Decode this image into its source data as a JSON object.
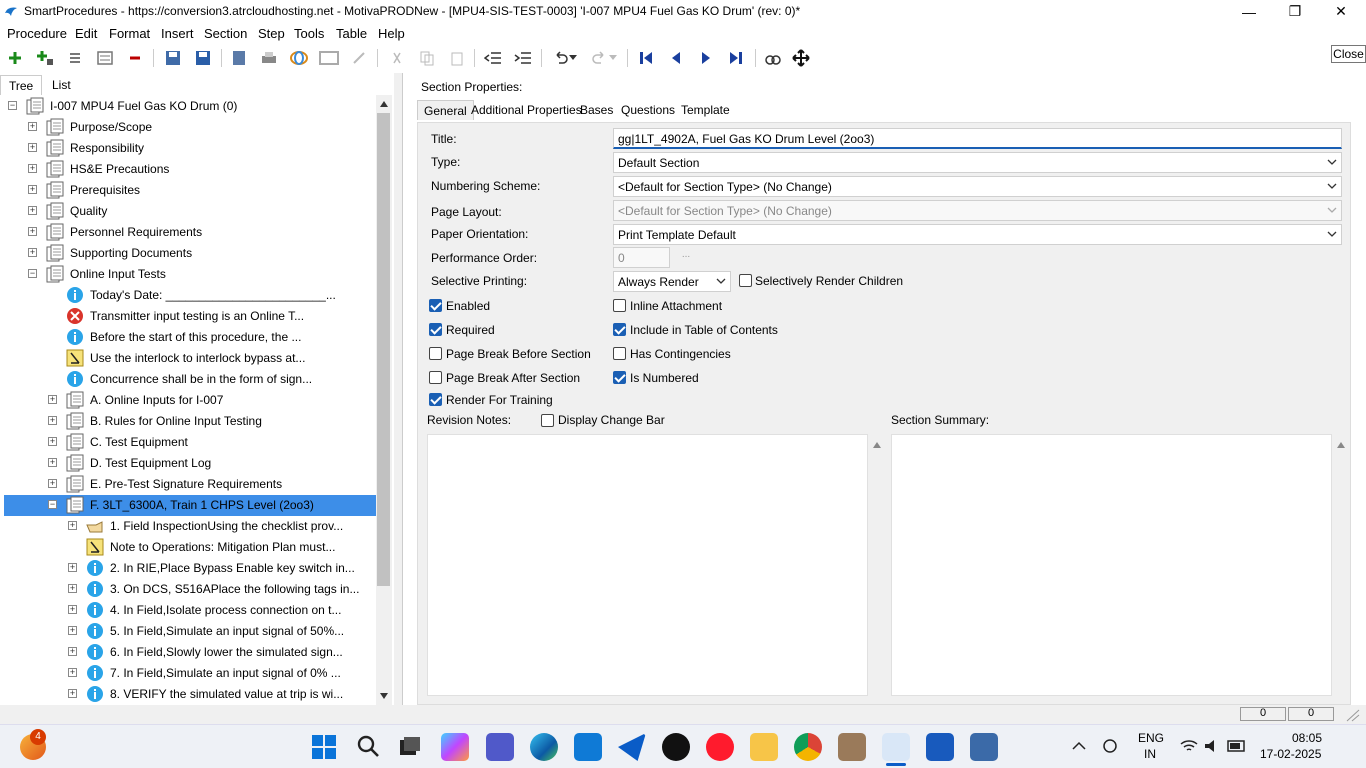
{
  "window": {
    "title": "SmartProcedures - https://conversion3.atrcloudhosting.net - MotivaPRODNew - [MPU4-SIS-TEST-0003] 'I-007 MPU4 Fuel Gas KO Drum' (rev: 0)*",
    "minimize": "—",
    "maximize": "❐",
    "close": "✕"
  },
  "menu": [
    "Procedure",
    "Edit",
    "Format",
    "Insert",
    "Section",
    "Step",
    "Tools",
    "Table",
    "Help"
  ],
  "close_button": "Close",
  "left_tabs": [
    "Tree",
    "List"
  ],
  "tree": [
    {
      "label": "I-007 MPU4 Fuel Gas KO Drum (0)",
      "icon": "document-icon",
      "pm": "−"
    },
    {
      "label": "Purpose/Scope",
      "icon": "document-icon",
      "pm": "+"
    },
    {
      "label": "Responsibility",
      "icon": "document-icon",
      "pm": "+"
    },
    {
      "label": "HS&E Precautions",
      "icon": "document-icon",
      "pm": "+"
    },
    {
      "label": "Prerequisites",
      "icon": "document-icon",
      "pm": "+"
    },
    {
      "label": "Quality",
      "icon": "document-icon",
      "pm": "+"
    },
    {
      "label": "Personnel Requirements",
      "icon": "document-icon",
      "pm": "+"
    },
    {
      "label": "Supporting Documents",
      "icon": "document-icon",
      "pm": "+"
    },
    {
      "label": "Online Input Tests",
      "icon": "document-icon",
      "pm": "−"
    },
    {
      "label": "Today's Date: ________________________...",
      "icon": "info-icon",
      "pm": ""
    },
    {
      "label": "Transmitter input testing is an Online T...",
      "icon": "error-icon",
      "pm": ""
    },
    {
      "label": "Before the start of this procedure, the ...",
      "icon": "info-icon",
      "pm": ""
    },
    {
      "label": "Use the interlock to interlock bypass at...",
      "icon": "warning-icon",
      "pm": ""
    },
    {
      "label": "Concurrence shall be in the form of sign...",
      "icon": "info-icon",
      "pm": ""
    },
    {
      "label": "A. Online Inputs for I-007",
      "icon": "document-icon",
      "pm": "+"
    },
    {
      "label": "B. Rules for Online Input Testing",
      "icon": "document-icon",
      "pm": "+"
    },
    {
      "label": "C. Test Equipment",
      "icon": "document-icon",
      "pm": "+"
    },
    {
      "label": "D. Test Equipment Log",
      "icon": "document-icon",
      "pm": "+"
    },
    {
      "label": "E. Pre-Test Signature Requirements",
      "icon": "document-icon",
      "pm": "+"
    },
    {
      "label": "F. 3LT_6300A, Train 1 CHPS Level (2oo3)",
      "icon": "document-icon",
      "pm": "−"
    },
    {
      "label": "1. Field InspectionUsing the checklist prov...",
      "icon": "hand-pointer-icon",
      "pm": "+"
    },
    {
      "label": "Note to Operations: Mitigation Plan must...",
      "icon": "warning-icon",
      "pm": ""
    },
    {
      "label": "2. In RIE,Place Bypass Enable key switch in...",
      "icon": "info-icon",
      "pm": "+"
    },
    {
      "label": "3. On DCS, S516APlace the following tags in...",
      "icon": "info-icon",
      "pm": "+"
    },
    {
      "label": "4. In Field,Isolate process connection on t...",
      "icon": "info-icon",
      "pm": "+"
    },
    {
      "label": "5. In Field,Simulate an input signal of 50%...",
      "icon": "info-icon",
      "pm": "+"
    },
    {
      "label": "6. In Field,Slowly lower the simulated sign...",
      "icon": "info-icon",
      "pm": "+"
    },
    {
      "label": "7. In Field,Simulate an input signal of 0% ...",
      "icon": "info-icon",
      "pm": "+"
    },
    {
      "label": "8. VERIFY the simulated value at trip is wi...",
      "icon": "info-icon",
      "pm": "+"
    }
  ],
  "section_properties": {
    "heading": "Section Properties:",
    "tabs": [
      "General",
      "Additional Properties",
      "Bases",
      "Questions",
      "Template"
    ],
    "labels": {
      "title": "Title:",
      "type": "Type:",
      "numbering": "Numbering Scheme:",
      "layout": "Page Layout:",
      "orientation": "Paper Orientation:",
      "perf_order": "Performance Order:",
      "selective": "Selective Printing:",
      "revision_notes": "Revision Notes:",
      "section_summary": "Section Summary:"
    },
    "values": {
      "title": "gg|1LT_4902A, Fuel Gas KO Drum Level (2oo3)",
      "type": "Default Section",
      "numbering": "<Default for Section Type> (No Change)",
      "layout": "<Default for Section Type> (No Change)",
      "orientation": "Print Template Default",
      "perf_order": "0",
      "perf_btn": "...",
      "selective": "Always Render"
    },
    "checkboxes": {
      "selectively_render_children": {
        "label": "Selectively Render Children",
        "checked": false
      },
      "enabled": {
        "label": "Enabled",
        "checked": true
      },
      "inline_attachment": {
        "label": "Inline Attachment",
        "checked": false
      },
      "required": {
        "label": "Required",
        "checked": true
      },
      "include_toc": {
        "label": "Include in Table of Contents",
        "checked": true
      },
      "page_break_before": {
        "label": "Page Break Before Section",
        "checked": false
      },
      "has_contingencies": {
        "label": "Has Contingencies",
        "checked": false
      },
      "page_break_after": {
        "label": "Page Break After Section",
        "checked": false
      },
      "is_numbered": {
        "label": "Is Numbered",
        "checked": true
      },
      "render_training": {
        "label": "Render For Training",
        "checked": true
      },
      "display_change_bar": {
        "label": "Display Change Bar",
        "checked": false
      }
    }
  },
  "status": {
    "left_count": "0",
    "right_count": "0"
  },
  "taskbar": {
    "notification_badge": "4",
    "lang": "ENG",
    "region": "IN",
    "time": "08:05",
    "date": "17-02-2025"
  },
  "colors": {
    "accent": "#1a5fb4",
    "selection": "#3d8ee8"
  }
}
